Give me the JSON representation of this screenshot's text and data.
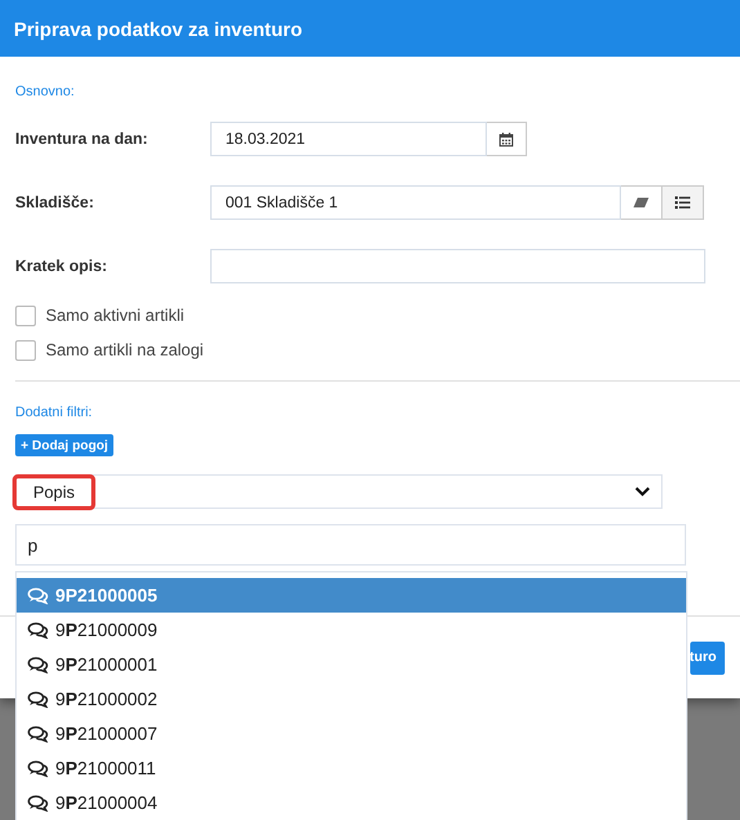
{
  "window": {
    "title": "Priprava podatkov za inventuro"
  },
  "sections": [
    {
      "title": "Osnovno:"
    },
    {
      "title": "Dodatni filtri:"
    }
  ],
  "fields": [
    {
      "label": "Inventura na dan:",
      "value": "18.03.2021",
      "kind": "date"
    },
    {
      "label": "Skladišče:",
      "value": "001 Skladišče 1",
      "kind": "lookup"
    },
    {
      "label": "Kratek opis:",
      "kind": "text"
    }
  ],
  "checkboxes": [
    {
      "label": "Samo aktivni artikli",
      "checked": false
    },
    {
      "label": "Samo artikli na zalogi",
      "checked": false
    }
  ],
  "add_button": "+ Dodaj pogoj",
  "filter_select": {
    "value": "Popis",
    "highlighted": true
  },
  "filter_input": {
    "value": "p"
  },
  "suggestions": [
    {
      "text": "9**P**21000005",
      "selected": true
    },
    {
      "text": "9**P**21000009",
      "selected": false
    },
    {
      "text": "9**P**21000001",
      "selected": false
    },
    {
      "text": "9**P**21000002",
      "selected": false
    },
    {
      "text": "9**P**21000007",
      "selected": false
    },
    {
      "text": "9**P**21000011",
      "selected": false
    },
    {
      "text": "9**P**21000004",
      "selected": false
    }
  ],
  "footer_button": "turo"
}
